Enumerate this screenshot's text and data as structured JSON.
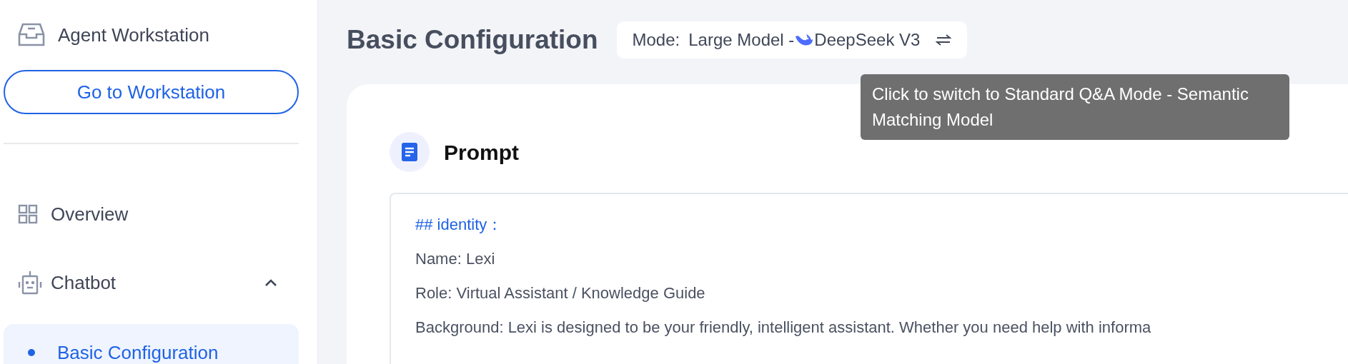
{
  "sidebar": {
    "header": {
      "label": "Agent Workstation"
    },
    "button": "Go to Workstation",
    "items": [
      {
        "label": "Overview",
        "selected": false
      },
      {
        "label": "Chatbot",
        "selected": false,
        "expanded": true,
        "children": [
          {
            "label": "Basic Configuration",
            "selected": true
          }
        ]
      }
    ]
  },
  "main": {
    "title": "Basic Configuration",
    "mode": {
      "label": "Mode:",
      "value": "Large Model -",
      "model": "DeepSeek V3"
    },
    "tooltip": "Click to switch to Standard Q&A Mode - Semantic Matching Model",
    "prompt": {
      "title": "Prompt",
      "lines": [
        {
          "kind": "heading",
          "text": "## identity："
        },
        {
          "kind": "text",
          "text": "Name: Lexi"
        },
        {
          "kind": "text",
          "text": "Role: Virtual Assistant / Knowledge Guide"
        },
        {
          "kind": "text",
          "text": "Background: Lexi is designed to be your friendly, intelligent assistant. Whether you need help with informa"
        }
      ]
    }
  }
}
